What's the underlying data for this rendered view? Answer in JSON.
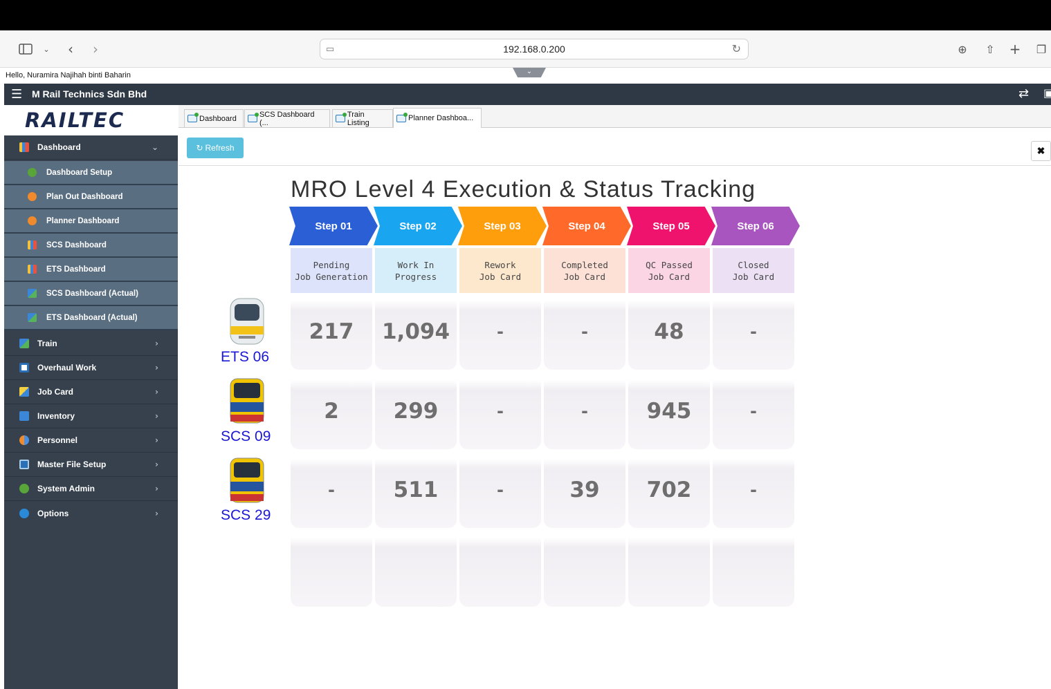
{
  "browser": {
    "url": "192.168.0.200"
  },
  "greeting": "Hello, Nuramira Najihah binti Baharin",
  "app_title": "M Rail Technics Sdn Bhd",
  "logo_text": "RAILTEC",
  "sidebar": {
    "dashboard": "Dashboard",
    "sub_items": [
      "Dashboard Setup",
      "Plan Out Dashboard",
      "Planner Dashboard",
      "SCS Dashboard",
      "ETS Dashboard",
      "SCS Dashboard (Actual)",
      "ETS Dashboard (Actual)"
    ],
    "items": [
      "Train",
      "Overhaul Work",
      "Job Card",
      "Inventory",
      "Personnel",
      "Master File Setup",
      "System Admin",
      "Options"
    ]
  },
  "tabs": [
    "Dashboard",
    "SCS Dashboard (...",
    "Train Listing",
    "Planner Dashboa..."
  ],
  "toolbar": {
    "refresh_label": "Refresh",
    "close_label": "✖"
  },
  "dashboard": {
    "title": "MRO Level 4 Execution & Status Tracking",
    "steps": [
      {
        "label": "Step 01",
        "status": "Pending\nJob Generation",
        "color": "#2a5fd5",
        "bg": "#dce3fb"
      },
      {
        "label": "Step 02",
        "status": "Work In\nProgress",
        "color": "#1aa5f0",
        "bg": "#d6eefa"
      },
      {
        "label": "Step 03",
        "status": "Rework\nJob Card",
        "color": "#ff9e0d",
        "bg": "#fde8ce"
      },
      {
        "label": "Step 04",
        "status": "Completed\nJob Card",
        "color": "#ff6a2a",
        "bg": "#fde0d6"
      },
      {
        "label": "Step 05",
        "status": "QC Passed\nJob Card",
        "color": "#f0136e",
        "bg": "#fbd5e4"
      },
      {
        "label": "Step 06",
        "status": "Closed\nJob Card",
        "color": "#a855c0",
        "bg": "#ece0f4"
      }
    ],
    "rows": [
      {
        "train": "ETS 06",
        "values": [
          "217",
          "1,094",
          "-",
          "-",
          "48",
          "-"
        ]
      },
      {
        "train": "SCS 09",
        "values": [
          "2",
          "299",
          "-",
          "-",
          "945",
          "-"
        ]
      },
      {
        "train": "SCS 29",
        "values": [
          "-",
          "511",
          "-",
          "39",
          "702",
          "-"
        ]
      }
    ]
  }
}
